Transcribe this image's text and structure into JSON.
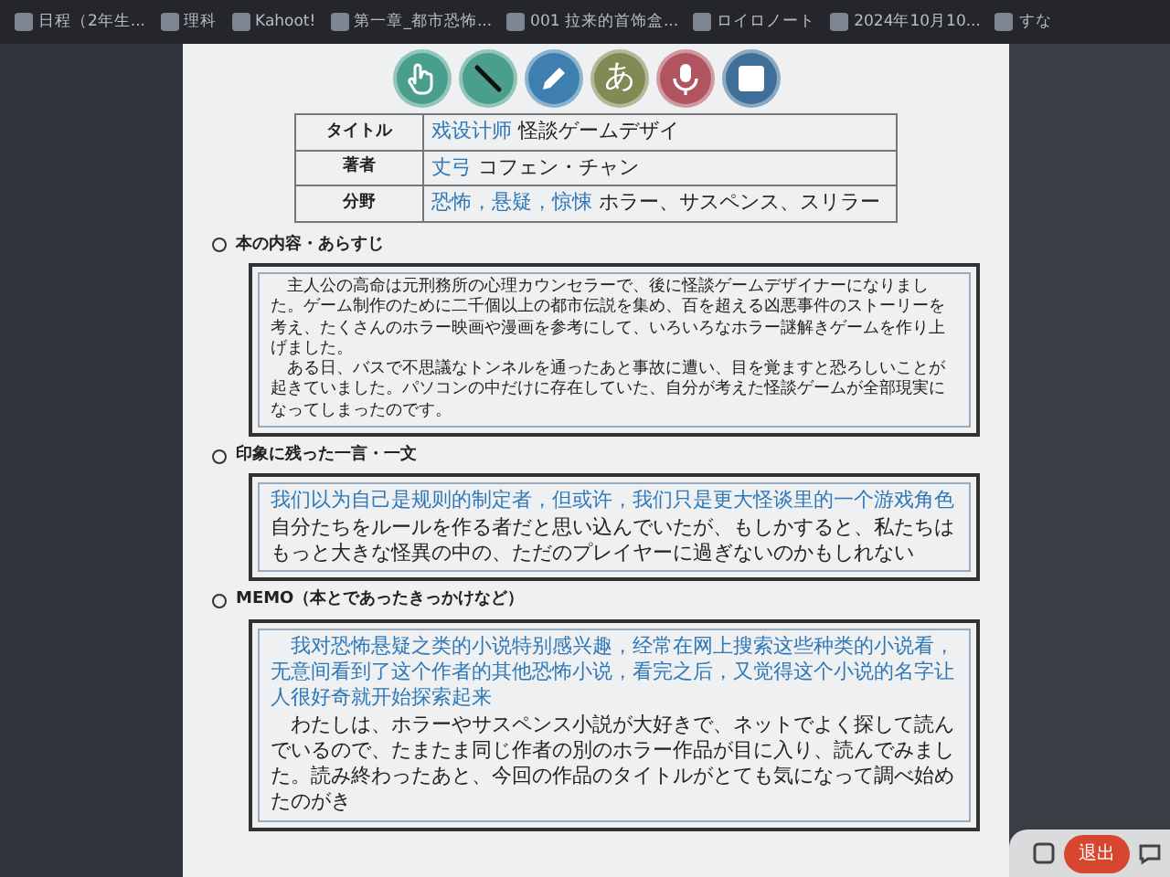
{
  "bookmarks": [
    {
      "label": "日程（2年生..."
    },
    {
      "label": "理科"
    },
    {
      "label": "Kahoot!"
    },
    {
      "label": "第一章_都市恐怖..."
    },
    {
      "label": "001 拉来的首饰盒..."
    },
    {
      "label": "ロイロノート"
    },
    {
      "label": "2024年10月10..."
    },
    {
      "label": "すな"
    }
  ],
  "toolbar": [
    {
      "kind": "hand"
    },
    {
      "kind": "wand"
    },
    {
      "kind": "pencil"
    },
    {
      "kind": "kana",
      "label": "あ"
    },
    {
      "kind": "mic"
    },
    {
      "kind": "square"
    }
  ],
  "info_table": [
    {
      "label": "タイトル",
      "value_cn": "戏设计师",
      "value_ja": "怪談ゲームデザイ"
    },
    {
      "label": "著者",
      "value_cn": "丈弓",
      "value_ja": "コフェン・チャン"
    },
    {
      "label": "分野",
      "value_cn": "恐怖，悬疑，惊悚",
      "value_ja": "ホラー、サスペンス、スリラー"
    }
  ],
  "sections": [
    {
      "heading": "本の内容・あらすじ",
      "paragraphs": [
        {
          "kind": "ja",
          "text": "主人公の高命は元刑務所の心理カウンセラーで、後に怪談ゲームデザイナーになりました。ゲーム制作のために二千個以上の都市伝説を集め、百を超える凶悪事件のストーリーを考え、たくさんのホラー映画や漫画を参考にして、いろいろなホラー謎解きゲームを作り上げました。"
        },
        {
          "kind": "ja",
          "text": "ある日、バスで不思議なトンネルを通ったあと事故に遭い、目を覚ますと恐ろしいことが起きていました。パソコンの中だけに存在していた、自分が考えた怪談ゲームが全部現実になってしまったのです。"
        }
      ]
    },
    {
      "heading": "印象に残った一言・一文",
      "paragraphs": [
        {
          "kind": "cn",
          "text": "我们以为自己是规则的制定者，但或许，我们只是更大怪谈里的一个游戏角色"
        },
        {
          "kind": "ja",
          "text": "自分たちをルールを作る者だと思い込んでいたが、もしかすると、私たちはもっと大きな怪異の中の、ただのプレイヤーに過ぎないのかもしれない"
        }
      ]
    },
    {
      "heading": "MEMO（本とであったきっかけなど）",
      "paragraphs": [
        {
          "kind": "cn",
          "text": "我对恐怖悬疑之类的小说特别感兴趣，经常在网上搜索这些种类的小说看，无意间看到了这个作者的其他恐怖小说，看完之后，又觉得这个小说的名字让人很好奇就开始探索起来"
        },
        {
          "kind": "ja",
          "text": "わたしは、ホラーやサスペンス小説が大好きで、ネットでよく探して読んでいるので、たまたま同じ作者の別のホラー作品が目に入り、読んでみました。読み終わったあと、今回の作品のタイトルがとても気になって調べ始めたのがき"
        }
      ]
    }
  ],
  "exit_button": "退出"
}
